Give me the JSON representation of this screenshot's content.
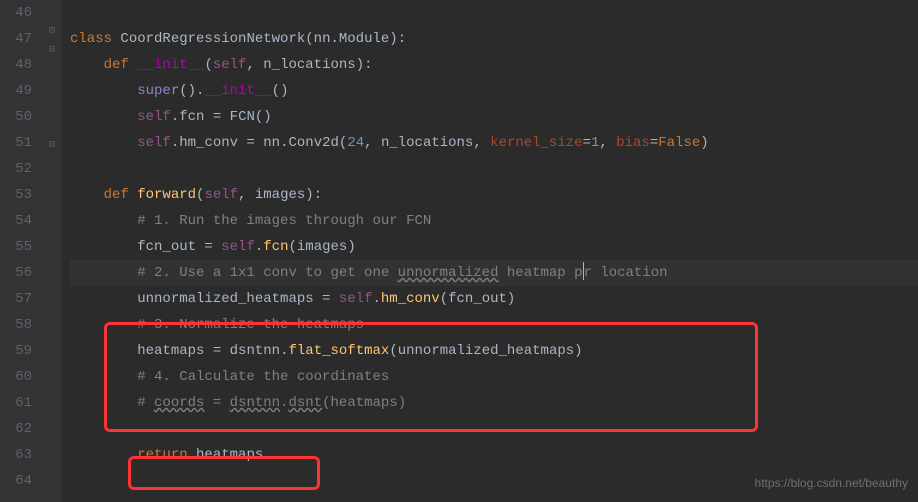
{
  "lines": {
    "l46": "46",
    "l47": "47",
    "l48": "48",
    "l49": "49",
    "l50": "50",
    "l51": "51",
    "l52": "52",
    "l53": "53",
    "l54": "54",
    "l55": "55",
    "l56": "56",
    "l57": "57",
    "l58": "58",
    "l59": "59",
    "l60": "60",
    "l61": "61",
    "l62": "62",
    "l63": "63",
    "l64": "64"
  },
  "code": {
    "class_kw": "class ",
    "class_name": "CoordRegressionNetwork",
    "class_paren_open": "(",
    "class_base": "nn.Module",
    "class_paren_close": "):",
    "def_kw": "def ",
    "init_name": "__init__",
    "init_params_open": "(",
    "self_param": "self",
    "comma": ", ",
    "n_locations": "n_locations",
    "params_close": "):",
    "super_call": "super",
    "empty_parens": "()",
    "dot": ".",
    "init_call": "__init__",
    "call_parens": "()",
    "self": "self",
    "fcn_attr": "fcn",
    "eq": " = ",
    "fcn_call": "FCN",
    "hm_conv": "hm_conv",
    "nn_mod": "nn",
    "conv2d": "Conv2d",
    "conv_open": "(",
    "num24": "24",
    "kernel_size_kw": "kernel_size",
    "eq_sign": "=",
    "num1": "1",
    "bias_kw": "bias",
    "false_val": "False",
    "conv_close": ")",
    "forward_name": "forward",
    "images_param": "images",
    "comment1": "# 1. Run the images through our FCN",
    "fcn_out": "fcn_out",
    "fcn_method": "fcn",
    "images_arg": "images",
    "paren_open": "(",
    "paren_close": ")",
    "comment2a": "# 2. Use a 1x1 conv to get one ",
    "comment2b": "unnormalized",
    "comment2c": " heatmap p",
    "comment2d": "r location",
    "unnorm_hm": "unnormalized_heatmaps",
    "hm_conv_call": "hm_conv",
    "fcn_out_arg": "fcn_out",
    "comment3": "# 3. Normalize the heatmaps",
    "heatmaps": "heatmaps",
    "dsntnn": "dsntnn",
    "flat_softmax": "flat_softmax",
    "unnorm_arg": "unnormalized_heatmaps",
    "comment4": "# 4. Calculate the coordinates",
    "comment5a": "# ",
    "comment5b": "coords",
    "comment5c": " = ",
    "comment5d": "dsntnn",
    "comment5e": ".",
    "comment5f": "dsnt",
    "comment5g": "(heatmaps)",
    "return_kw": "return ",
    "return_val": "heatmaps"
  },
  "watermark": "https://blog.csdn.net/beauthy"
}
